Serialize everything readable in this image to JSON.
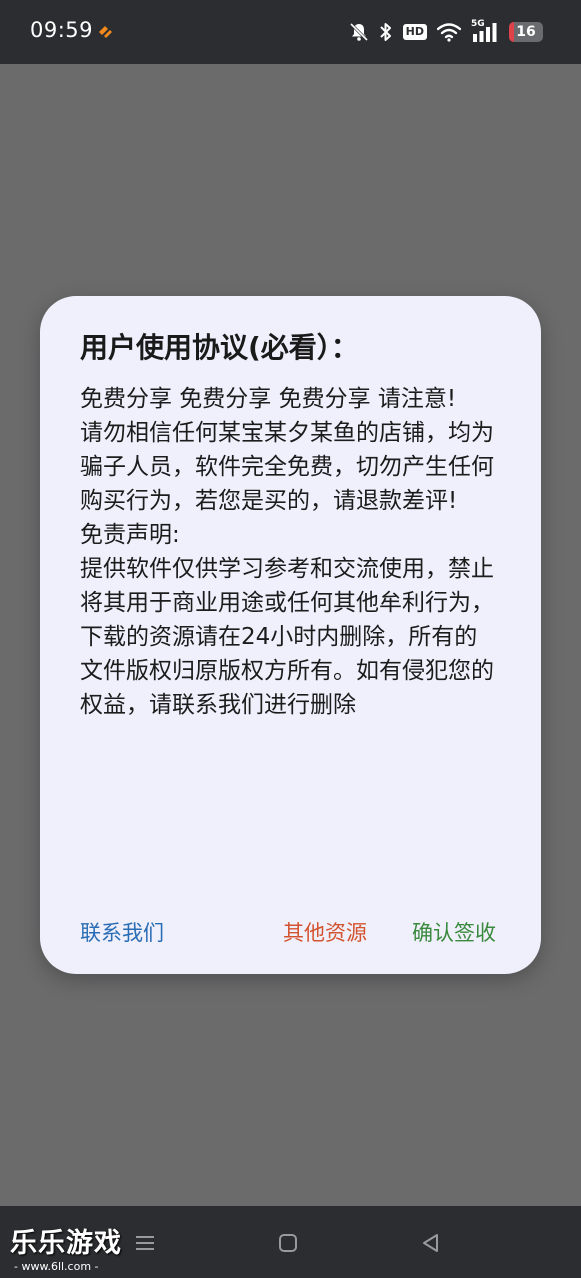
{
  "status_bar": {
    "time": "09:59",
    "hd_label": "HD",
    "network_label": "5G",
    "battery_level": "16",
    "icons": [
      "app-notification-icon",
      "bell-muted-icon",
      "bluetooth-icon",
      "hd-icon",
      "wifi-icon",
      "signal-icon",
      "battery-icon"
    ]
  },
  "dialog": {
    "title": "用户使用协议(必看）：",
    "body": "免费分享 免费分享 免费分享 请注意!\n请勿相信任何某宝某夕某鱼的店铺，均为骗子人员，软件完全免费，切勿产生任何购买行为，若您是买的，请退款差评!\n免责声明:\n提供软件仅供学习参考和交流使用，禁止将其用于商业用途或任何其他牟利行为，下载的资源请在24小时内删除，所有的文件版权归原版权方所有。如有侵犯您的权益，请联系我们进行删除",
    "buttons": {
      "contact": "联系我们",
      "resources": "其他资源",
      "confirm": "确认签收"
    }
  },
  "nav_bar": {
    "icons": [
      "menu-icon",
      "home-icon",
      "back-icon"
    ]
  },
  "watermark": {
    "title": "乐乐游戏",
    "url": "- www.6ll.com -"
  },
  "colors": {
    "overlay": "#6b6b6c",
    "dialog_bg": "#eff0fc",
    "contact": "#2a6db4",
    "resources": "#d4532f",
    "confirm": "#3a8a3e",
    "bars": "#2c2d30"
  }
}
